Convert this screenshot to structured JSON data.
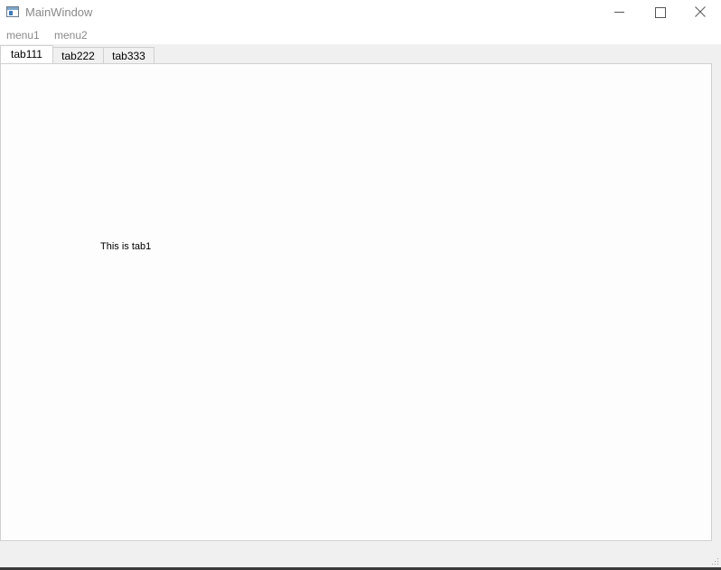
{
  "window": {
    "title": "MainWindow"
  },
  "menubar": {
    "items": [
      {
        "label": "menu1"
      },
      {
        "label": "menu2"
      }
    ]
  },
  "tabs": [
    {
      "label": "tab111",
      "active": true
    },
    {
      "label": "tab222",
      "active": false
    },
    {
      "label": "tab333",
      "active": false
    }
  ],
  "content": {
    "text": "This is tab1"
  },
  "icons": {
    "app": "app-window-icon",
    "minimize": "minimize-icon",
    "maximize": "maximize-icon",
    "close": "close-icon",
    "grip": "size-grip-icon"
  }
}
